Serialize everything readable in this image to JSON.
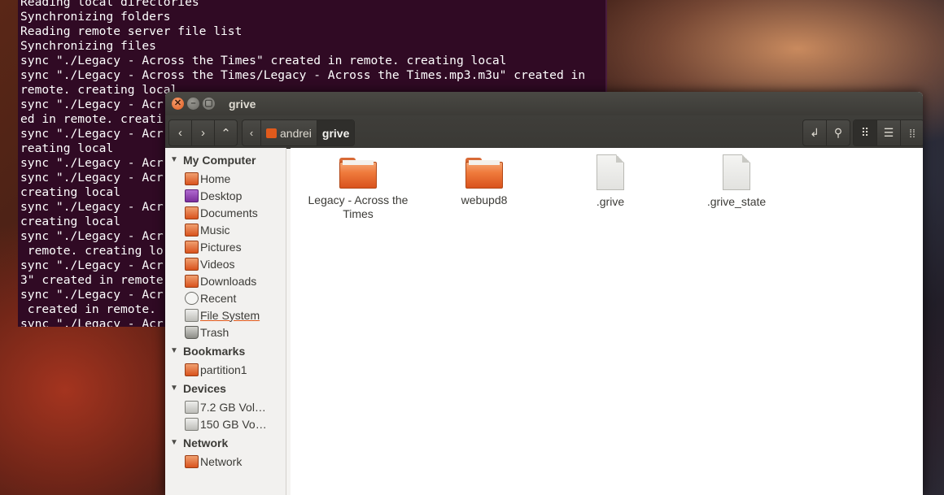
{
  "terminal": {
    "lines": [
      "Reading local directories",
      "Synchronizing folders",
      "Reading remote server file list",
      "Synchronizing files",
      "sync \"./Legacy - Across the Times\" created in remote. creating local",
      "sync \"./Legacy - Across the Times/Legacy - Across the Times.mp3.m3u\" created in",
      "remote. creating local",
      "sync \"./Legacy - Acr",
      "ed in remote. creati",
      "sync \"./Legacy - Acr",
      "reating local",
      "sync \"./Legacy - Acr",
      "sync \"./Legacy - Acr",
      "creating local",
      "sync \"./Legacy - Acr",
      "creating local",
      "sync \"./Legacy - Acr",
      " remote. creating lo",
      "sync \"./Legacy - Acr",
      "3\" created in remote",
      "sync \"./Legacy - Acr",
      " created in remote.",
      "sync \"./Legacy - Acr"
    ]
  },
  "window": {
    "title": "grive",
    "close_glyph": "✕",
    "min_glyph": "–",
    "max_glyph": "▢"
  },
  "toolbar": {
    "back_icon": "‹",
    "forward_icon": "›",
    "up_icon": "⌃",
    "path_left_icon": "‹",
    "breadcrumbs": [
      "andrei",
      "grive"
    ],
    "search_icon": "⚲",
    "enter_location_icon": "↲",
    "icon_view_icon": "⠿",
    "list_view_icon": "☰",
    "compact_view_icon": "⁞⁞"
  },
  "sidebar": {
    "my_computer": {
      "label": "My Computer",
      "items": [
        "Home",
        "Desktop",
        "Documents",
        "Music",
        "Pictures",
        "Videos",
        "Downloads",
        "Recent",
        "File System",
        "Trash"
      ]
    },
    "bookmarks": {
      "label": "Bookmarks",
      "items": [
        "partition1"
      ]
    },
    "devices": {
      "label": "Devices",
      "items": [
        "7.2 GB Vol…",
        "150 GB Vo…"
      ]
    },
    "network": {
      "label": "Network",
      "items": [
        "Network"
      ]
    }
  },
  "files": [
    {
      "name_line1": "Legacy - Across the",
      "name_line2": "Times",
      "type": "folder"
    },
    {
      "name_line1": "webupd8",
      "name_line2": "",
      "type": "folder"
    },
    {
      "name_line1": ".grive",
      "name_line2": "",
      "type": "document"
    },
    {
      "name_line1": ".grive_state",
      "name_line2": "",
      "type": "document"
    }
  ]
}
